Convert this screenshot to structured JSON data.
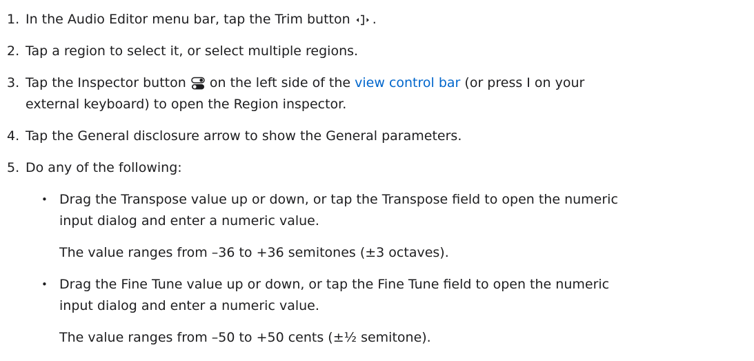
{
  "steps": [
    {
      "number": "1.",
      "before": "In the Audio Editor menu bar, tap the Trim button",
      "after": ".",
      "icon": "trim-icon"
    },
    {
      "number": "2.",
      "text": "Tap a region to select it, or select multiple regions."
    },
    {
      "number": "3.",
      "before": "Tap the Inspector button",
      "middle": "on the left side of the",
      "link": "view control bar",
      "after": "(or press I on your",
      "line2": "external keyboard) to open the Region inspector.",
      "icon": "inspector-icon"
    },
    {
      "number": "4.",
      "text": "Tap the General disclosure arrow to show the General parameters."
    },
    {
      "number": "5.",
      "text": "Do any of the following:"
    }
  ],
  "bullets": [
    {
      "line1": "Drag the Transpose value up or down, or tap the Transpose field to open the numeric",
      "line2": "input dialog and enter a numeric value.",
      "note": "The value ranges from –36 to +36 semitones (±3 octaves)."
    },
    {
      "line1": "Drag the Fine Tune value up or down, or tap the Fine Tune field to open the numeric",
      "line2": "input dialog and enter a numeric value.",
      "note": "The value ranges from –50 to +50 cents (±½ semitone)."
    }
  ],
  "bullet_glyph": "•",
  "colors": {
    "text": "#1d1d1f",
    "link": "#0066cc"
  }
}
